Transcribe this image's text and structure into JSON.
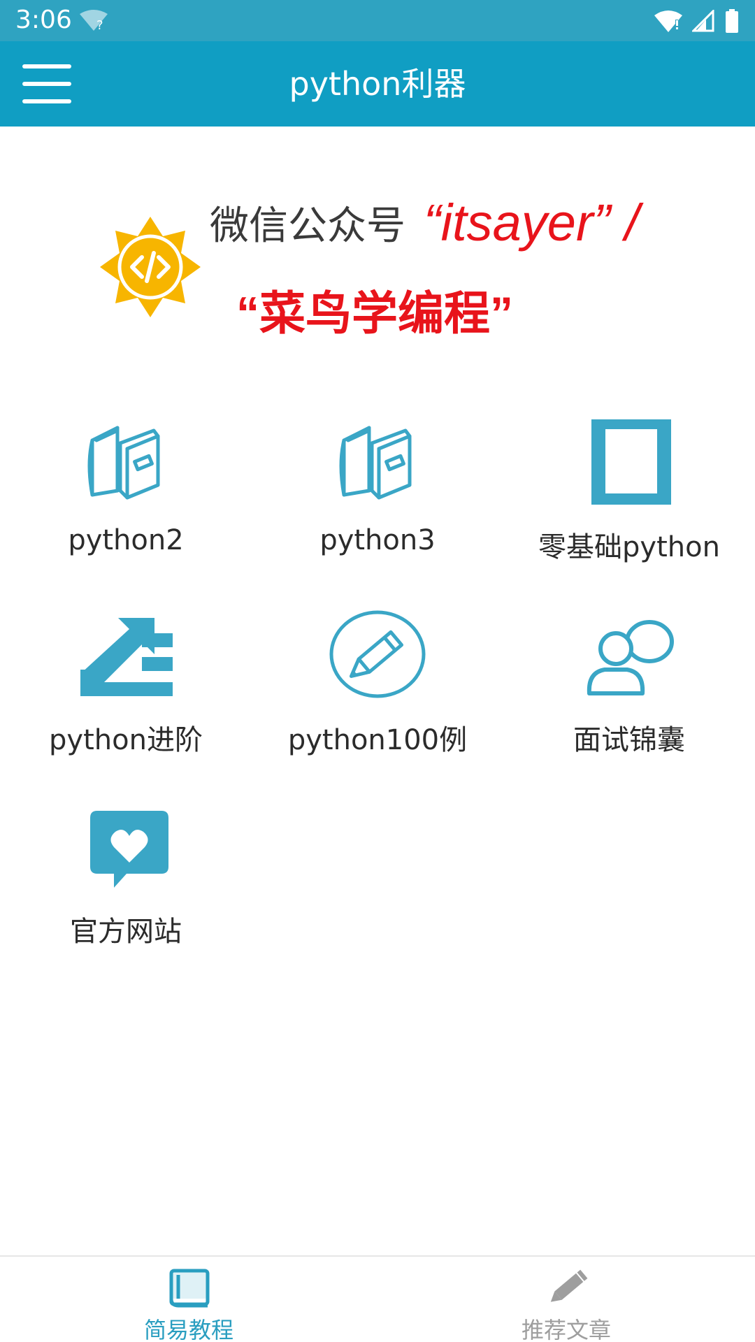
{
  "status_bar": {
    "time": "3:06"
  },
  "app_bar": {
    "title": "python利器"
  },
  "banner": {
    "line1_prefix": "微信公众号",
    "line1_highlight": "“itsayer”  /",
    "line2": "“菜鸟学编程”"
  },
  "grid": {
    "items": [
      {
        "label": "python2",
        "icon": "books-icon"
      },
      {
        "label": "python3",
        "icon": "books-icon"
      },
      {
        "label": "零基础python",
        "icon": "square-frame-icon"
      },
      {
        "label": "python进阶",
        "icon": "trending-list-icon"
      },
      {
        "label": "python100例",
        "icon": "pencil-circle-icon"
      },
      {
        "label": "面试锦囊",
        "icon": "user-chat-icon"
      },
      {
        "label": "官方网站",
        "icon": "heart-message-icon"
      }
    ]
  },
  "bottom_nav": {
    "items": [
      {
        "label": "简易教程",
        "icon": "book-icon",
        "active": true
      },
      {
        "label": "推荐文章",
        "icon": "pencil-icon",
        "active": false
      }
    ]
  },
  "colors": {
    "status_bar": "#2fa3c1",
    "app_bar": "#109ec3",
    "icon_blue": "#3aa6c6",
    "banner_red": "#e8141b",
    "logo_yellow": "#f7b500",
    "nav_active": "#2a9ec0",
    "nav_inactive": "#9e9e9e"
  }
}
